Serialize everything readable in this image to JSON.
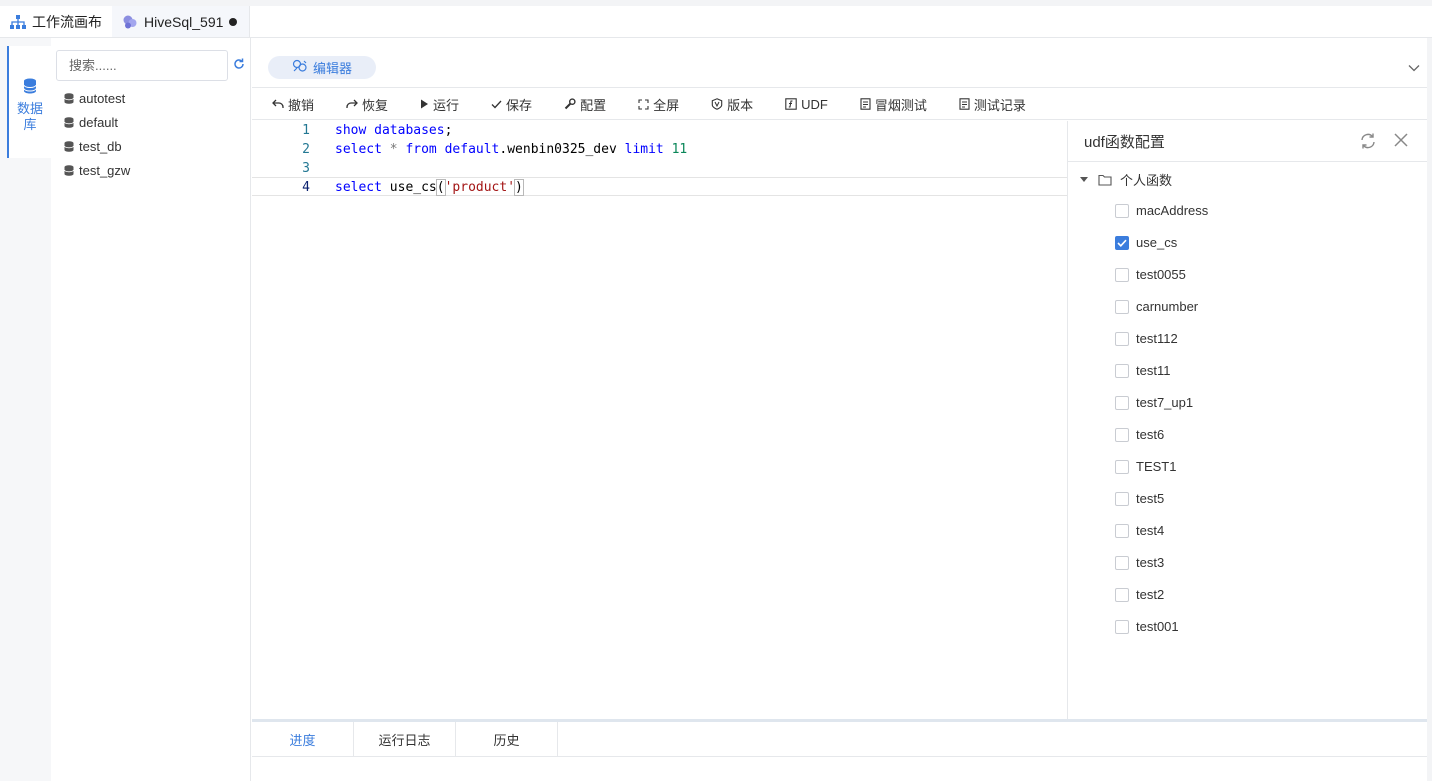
{
  "tabs": [
    {
      "label": "工作流画布",
      "icon": "sitemap-icon"
    },
    {
      "label": "HiveSql_591",
      "icon": "hive-icon",
      "unsaved": true
    }
  ],
  "leftnav": {
    "database_label": "数据库"
  },
  "dbpanel": {
    "search_placeholder": "搜索......",
    "databases": [
      "autotest",
      "default",
      "test_db",
      "test_gzw"
    ]
  },
  "editor": {
    "mode_label": "编辑器",
    "toolbar": {
      "undo": "撤销",
      "redo": "恢复",
      "run": "运行",
      "save": "保存",
      "config": "配置",
      "fullscreen": "全屏",
      "version": "版本",
      "udf": "UDF",
      "smoke_test": "冒烟测试",
      "test_record": "测试记录"
    },
    "lines": [
      {
        "num": "1",
        "tokens": [
          [
            "kw",
            "show"
          ],
          [
            "",
            " "
          ],
          [
            "kw",
            "databases"
          ],
          [
            "",
            ";"
          ]
        ]
      },
      {
        "num": "2",
        "tokens": [
          [
            "kw",
            "select"
          ],
          [
            "",
            " "
          ],
          [
            "op",
            "*"
          ],
          [
            "",
            " "
          ],
          [
            "kw",
            "from"
          ],
          [
            "",
            " "
          ],
          [
            "kw",
            "default"
          ],
          [
            "",
            ".wenbin0325_dev "
          ],
          [
            "kw",
            "limit"
          ],
          [
            "",
            " "
          ],
          [
            "numv",
            "11"
          ]
        ]
      },
      {
        "num": "3",
        "tokens": []
      },
      {
        "num": "4",
        "tokens": [
          [
            "kw",
            "select"
          ],
          [
            "",
            " use_cs"
          ],
          [
            "brk",
            "("
          ],
          [
            "str",
            "'product'"
          ],
          [
            "brk",
            ")"
          ]
        ]
      }
    ]
  },
  "udf": {
    "title": "udf函数配置",
    "folder": "个人函数",
    "functions": [
      {
        "name": "macAddress",
        "checked": false
      },
      {
        "name": "use_cs",
        "checked": true
      },
      {
        "name": "test0055",
        "checked": false
      },
      {
        "name": "carnumber",
        "checked": false
      },
      {
        "name": "test112",
        "checked": false
      },
      {
        "name": "test11",
        "checked": false
      },
      {
        "name": "test7_up1",
        "checked": false
      },
      {
        "name": "test6",
        "checked": false
      },
      {
        "name": "TEST1",
        "checked": false
      },
      {
        "name": "test5",
        "checked": false
      },
      {
        "name": "test4",
        "checked": false
      },
      {
        "name": "test3",
        "checked": false
      },
      {
        "name": "test2",
        "checked": false
      },
      {
        "name": "test001",
        "checked": false
      }
    ]
  },
  "bottom_tabs": [
    "进度",
    "运行日志",
    "历史"
  ],
  "colors": {
    "accent": "#3b7ddd",
    "keyword": "#0000ff",
    "string": "#a31515",
    "number": "#098658"
  }
}
